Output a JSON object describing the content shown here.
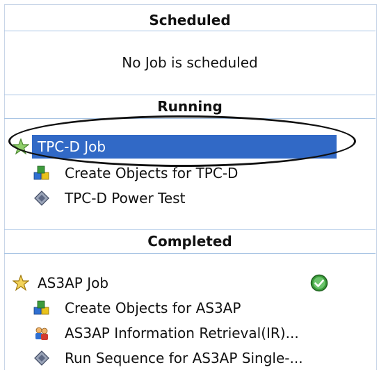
{
  "sections": {
    "scheduled": {
      "title": "Scheduled",
      "empty_message": "No Job is scheduled"
    },
    "running": {
      "title": "Running",
      "job": {
        "label": "TPC-D Job",
        "icon": "job-star-icon",
        "selected": true
      },
      "tasks": [
        {
          "label": "Create Objects for TPC-D",
          "icon": "create-objects-icon"
        },
        {
          "label": "TPC-D Power Test",
          "icon": "power-test-icon"
        }
      ]
    },
    "completed": {
      "title": "Completed",
      "job": {
        "label": "AS3AP Job",
        "icon": "job-star-icon",
        "status_icon": "success-check-icon"
      },
      "tasks": [
        {
          "label": "Create Objects for AS3AP",
          "icon": "create-objects-icon"
        },
        {
          "label": "AS3AP Information Retrieval(IR)...",
          "icon": "users-icon"
        },
        {
          "label": "Run Sequence for AS3AP Single-...",
          "icon": "power-test-icon"
        }
      ]
    }
  },
  "colors": {
    "selection": "#3169c6",
    "divider": "#a8c4e4",
    "success": "#3a9b3a"
  }
}
